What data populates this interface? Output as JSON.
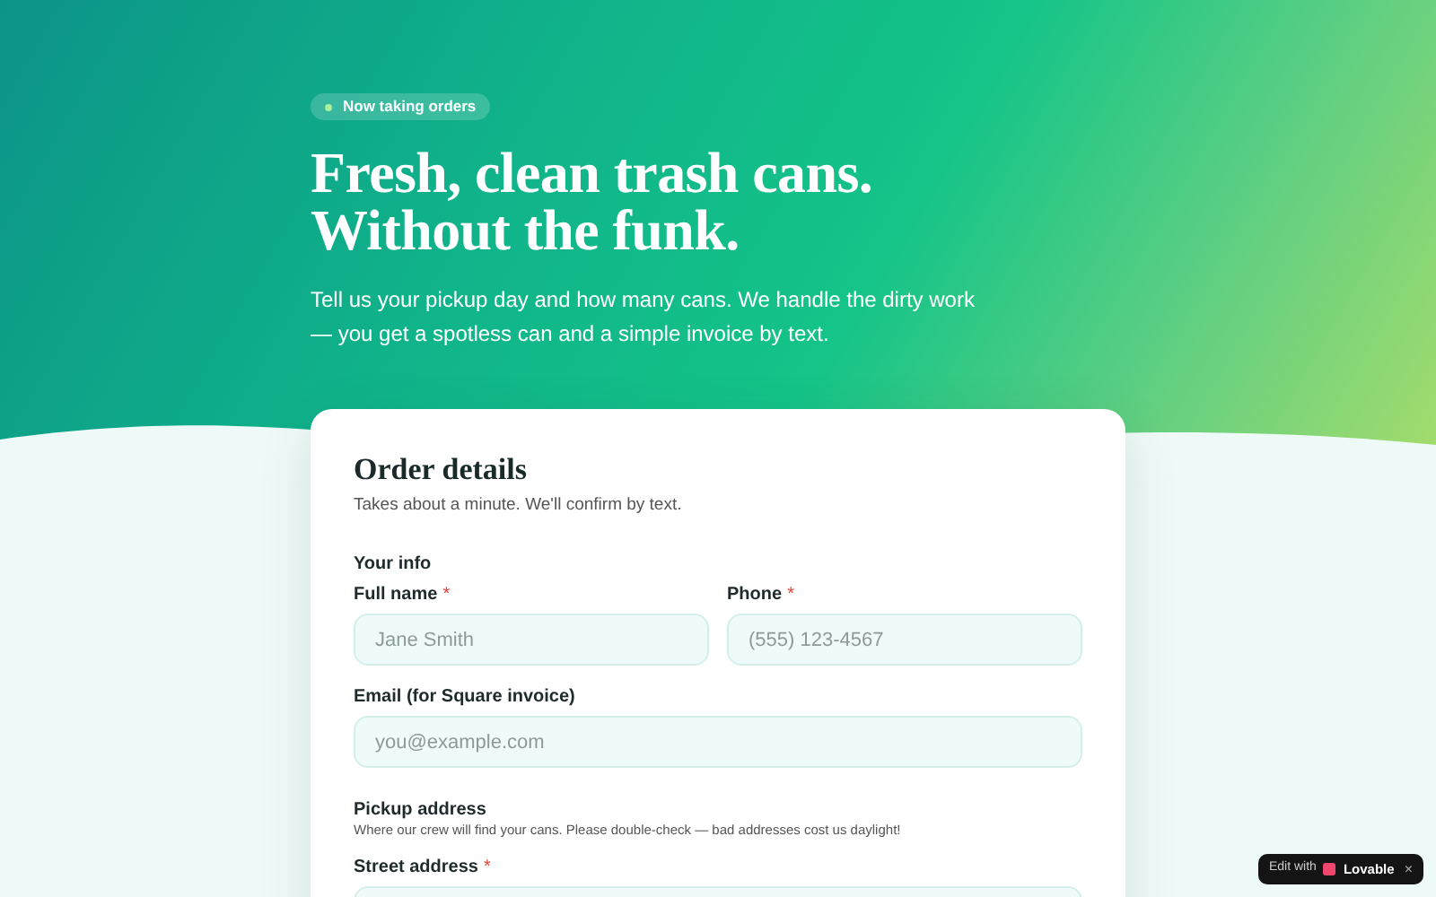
{
  "hero": {
    "badge": "Now taking orders",
    "title_lines": [
      "Fresh, clean trash cans.",
      "Without the funk."
    ],
    "intro": "Tell us your pickup day and how many cans. We handle the dirty work — you get a spotless can and a simple invoice by text."
  },
  "form": {
    "required_mark": "*",
    "title": "Order details",
    "subtitle": "Takes about a minute. We'll confirm by text.",
    "sections": [
      {
        "heading": "Your info",
        "rows": [
          [
            {
              "label": "Full name",
              "required": true,
              "placeholder": "Jane Smith"
            },
            {
              "label": "Phone",
              "required": true,
              "placeholder": "(555) 123-4567"
            }
          ],
          [
            {
              "label": "Email (for Square invoice)",
              "required": false,
              "placeholder": "you@example.com"
            }
          ]
        ]
      },
      {
        "heading": "Pickup address",
        "helper": "Where our crew will find your cans. Please double-check — bad addresses cost us daylight!",
        "rows": [
          [
            {
              "label": "Street address",
              "required": true
            }
          ]
        ]
      }
    ]
  },
  "edit_badge": {
    "prefix": "Edit with",
    "brand": "Lovable",
    "close": "×"
  }
}
